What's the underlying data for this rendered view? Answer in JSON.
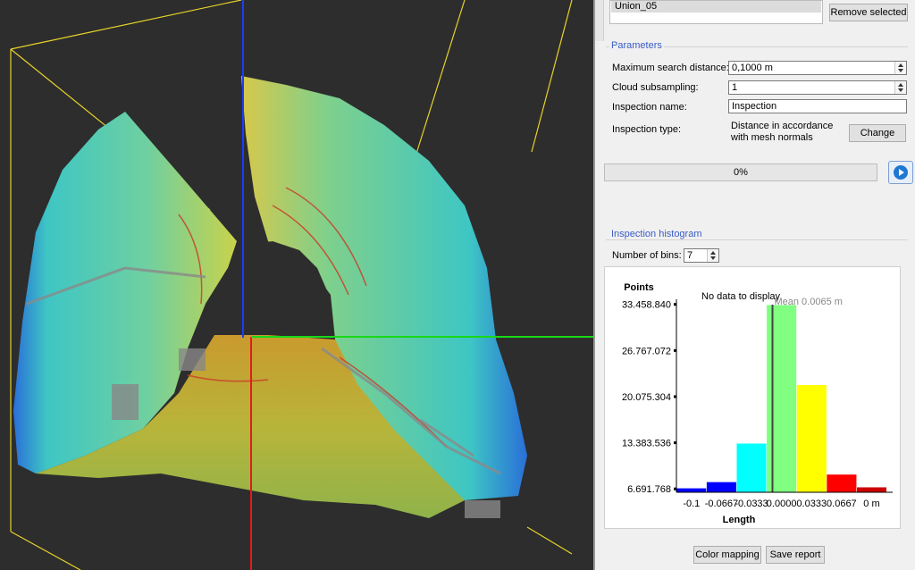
{
  "selection": {
    "item": "Union_05",
    "remove_button": "Remove selected"
  },
  "parameters": {
    "title": "Parameters",
    "max_search_label": "Maximum search distance:",
    "max_search_value": "0,1000 m",
    "subsampling_label": "Cloud subsampling:",
    "subsampling_value": "1",
    "inspection_name_label": "Inspection name:",
    "inspection_name_value": "Inspection",
    "inspection_type_label": "Inspection type:",
    "inspection_type_line1": "Distance in accordance",
    "inspection_type_line2": "with mesh normals",
    "change_button": "Change"
  },
  "progress": {
    "text": "0%",
    "value": 0
  },
  "histogram": {
    "title": "Inspection histogram",
    "bins_label": "Number of bins:",
    "bins_value": "7",
    "no_data": "No data to display",
    "mean_label": "Mean 0.0065 m"
  },
  "footer": {
    "color_mapping": "Color mapping",
    "save_report": "Save report"
  },
  "colors": {
    "accent": "#3a5cc6",
    "viewport_bg": "#2d2d2d"
  },
  "chart_data": {
    "type": "bar",
    "ylabel": "Points",
    "xlabel": "Length",
    "y_ticks": [
      "33.458.840",
      "26.767.072",
      "20.075.304",
      "13.383.536",
      "6.691.768"
    ],
    "y_tick_values": [
      33458840,
      26767072,
      20075304,
      13383536,
      6691768
    ],
    "x_tick_labels": [
      "-0.1",
      "-0.0667",
      "-0.0333",
      "0.0000",
      "0.0333",
      "0.0667",
      "0 m"
    ],
    "ylim": [
      6200000,
      34200000
    ],
    "categories": [
      "-0.1 to -0.0667",
      "-0.0667 to -0.0333",
      "-0.0333 to 0",
      "0 to 0.0333",
      "0.0333 to 0.0667",
      "0.0667 to 0.1",
      "0.1+"
    ],
    "values": [
      6800000,
      7700000,
      13300000,
      33400000,
      21800000,
      8800000,
      6950000
    ],
    "bar_colors": [
      "#0000ff",
      "#0000ff",
      "#00ffff",
      "#80ff80",
      "#ffff00",
      "#ff0000",
      "#cc0000"
    ],
    "mean": 0.0065
  }
}
